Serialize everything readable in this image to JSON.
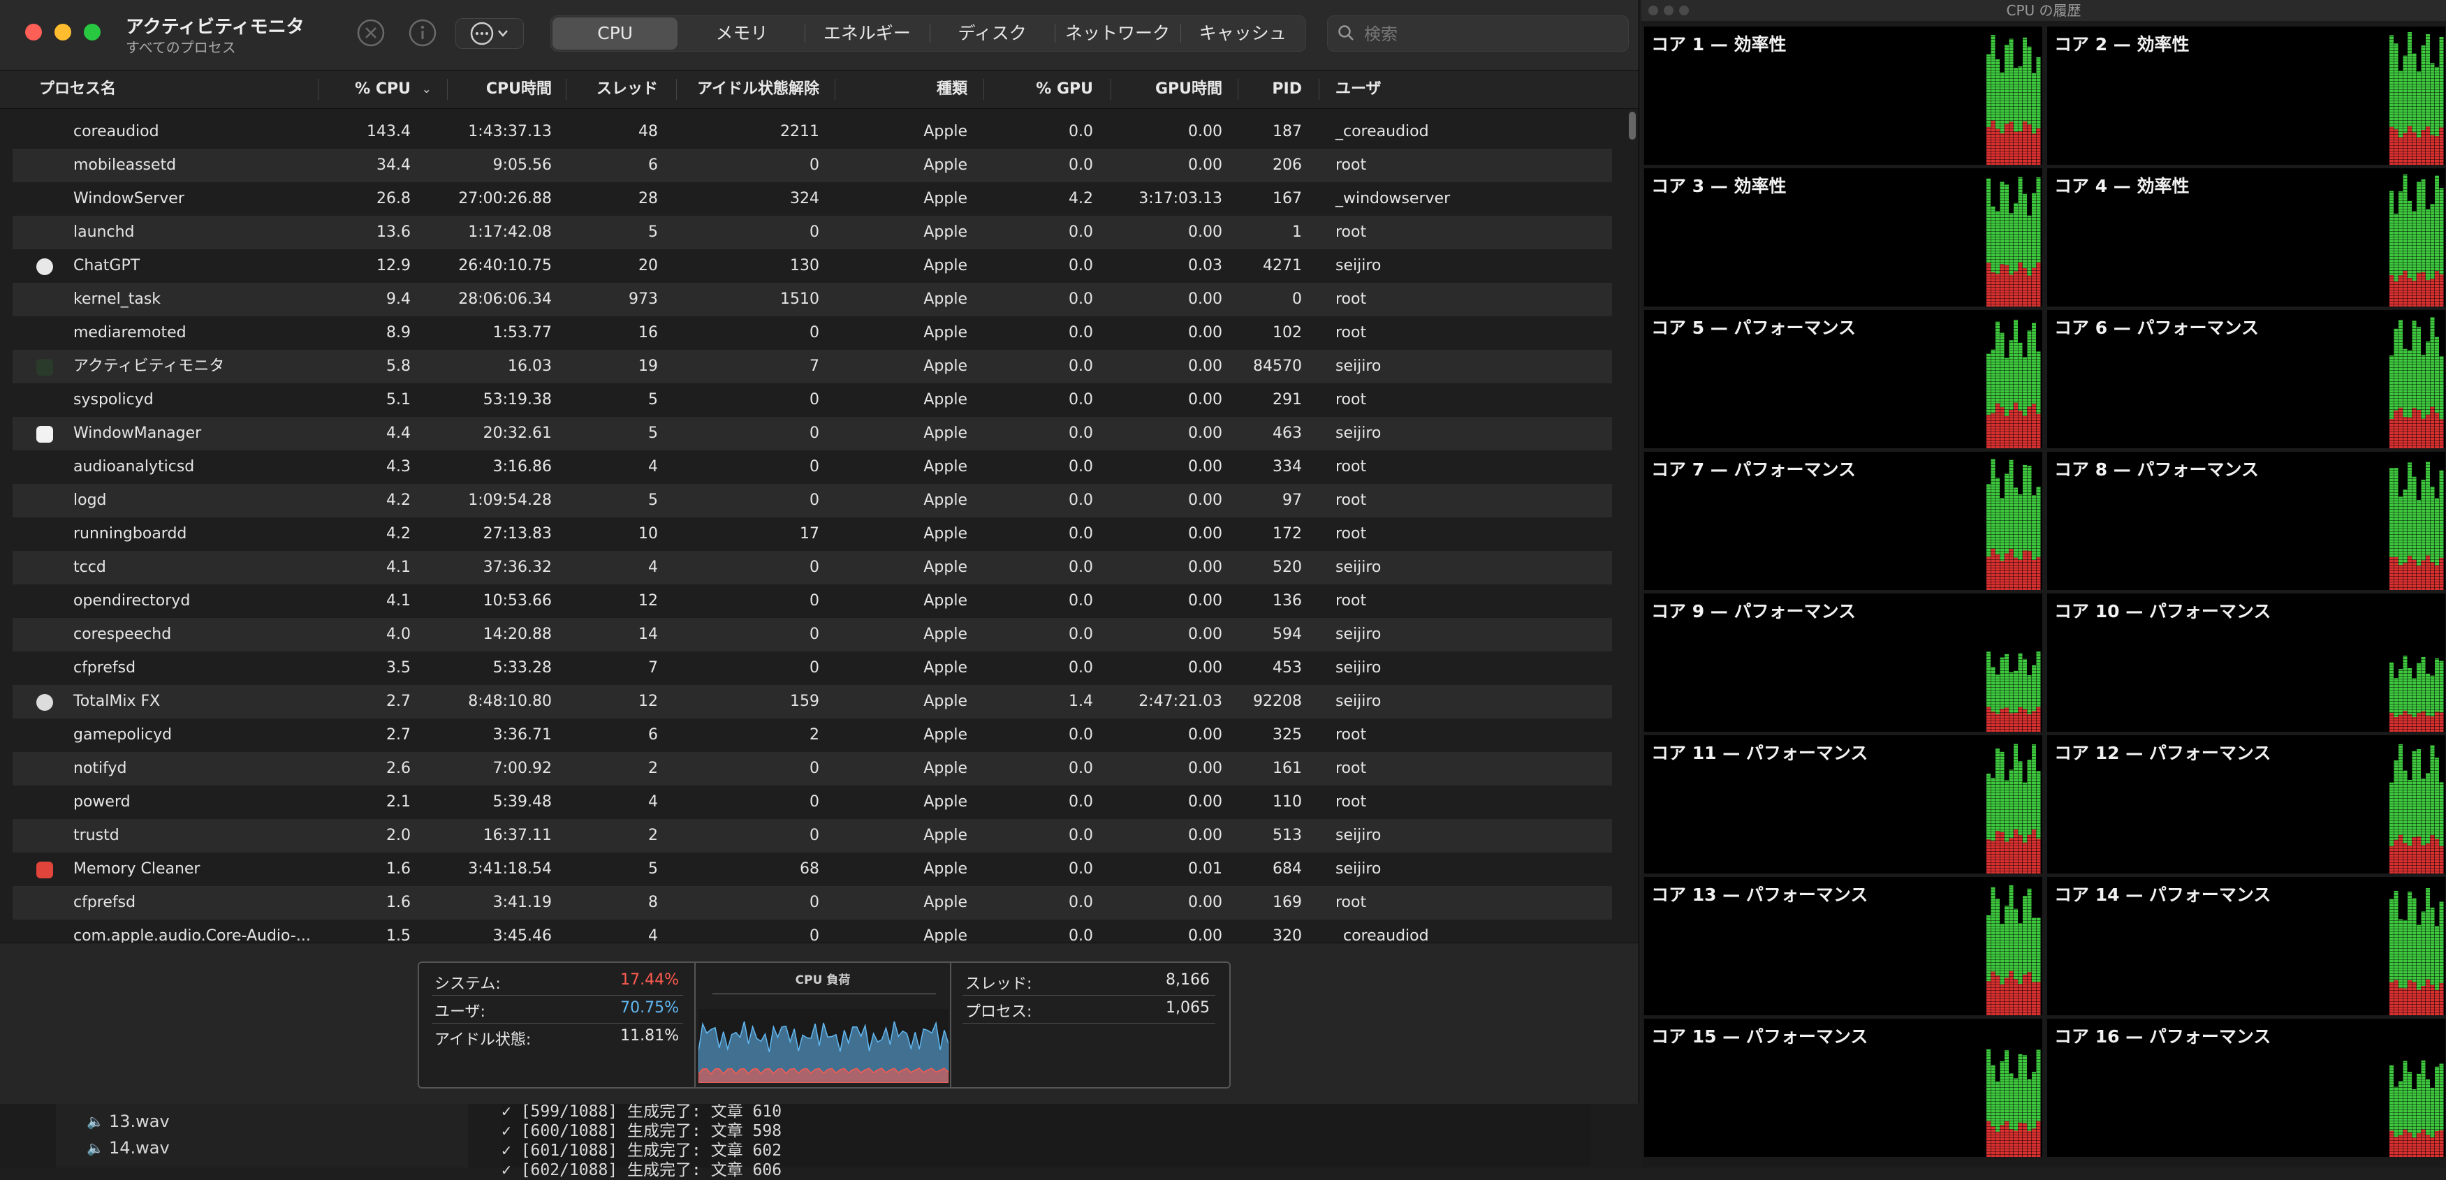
{
  "window": {
    "title": "アクティビティモニタ",
    "subtitle": "すべてのプロセス"
  },
  "toolbar": {
    "stop_icon": "x-circle-icon",
    "info_icon": "info-icon",
    "more_icon": "ellipsis-icon"
  },
  "tabs": [
    "CPU",
    "メモリ",
    "エネルギー",
    "ディスク",
    "ネットワーク",
    "キャッシュ"
  ],
  "active_tab": "CPU",
  "search": {
    "placeholder": "検索",
    "value": ""
  },
  "columns": [
    "プロセス名",
    "% CPU",
    "CPU時間",
    "スレッド",
    "アイドル状態解除",
    "種類",
    "% GPU",
    "GPU時間",
    "PID",
    "ユーザ"
  ],
  "processes": [
    {
      "name": "coreaudiod",
      "cpu": "143.4",
      "cpu_time": "1:43:37.13",
      "threads": "48",
      "wakeups": "2211",
      "kind": "Apple",
      "gpu": "0.0",
      "gpu_time": "0.00",
      "pid": "187",
      "user": "_coreaudiod",
      "icon": ""
    },
    {
      "name": "mobileassetd",
      "cpu": "34.4",
      "cpu_time": "9:05.56",
      "threads": "6",
      "wakeups": "0",
      "kind": "Apple",
      "gpu": "0.0",
      "gpu_time": "0.00",
      "pid": "206",
      "user": "root",
      "icon": ""
    },
    {
      "name": "WindowServer",
      "cpu": "26.8",
      "cpu_time": "27:00:26.88",
      "threads": "28",
      "wakeups": "324",
      "kind": "Apple",
      "gpu": "4.2",
      "gpu_time": "3:17:03.13",
      "pid": "167",
      "user": "_windowserver",
      "icon": ""
    },
    {
      "name": "launchd",
      "cpu": "13.6",
      "cpu_time": "1:17:42.08",
      "threads": "5",
      "wakeups": "0",
      "kind": "Apple",
      "gpu": "0.0",
      "gpu_time": "0.00",
      "pid": "1",
      "user": "root",
      "icon": ""
    },
    {
      "name": "ChatGPT",
      "cpu": "12.9",
      "cpu_time": "26:40:10.75",
      "threads": "20",
      "wakeups": "130",
      "kind": "Apple",
      "gpu": "0.0",
      "gpu_time": "0.03",
      "pid": "4271",
      "user": "seijiro",
      "icon": "chatgpt-icon"
    },
    {
      "name": "kernel_task",
      "cpu": "9.4",
      "cpu_time": "28:06:06.34",
      "threads": "973",
      "wakeups": "1510",
      "kind": "Apple",
      "gpu": "0.0",
      "gpu_time": "0.00",
      "pid": "0",
      "user": "root",
      "icon": ""
    },
    {
      "name": "mediaremoted",
      "cpu": "8.9",
      "cpu_time": "1:53.77",
      "threads": "16",
      "wakeups": "0",
      "kind": "Apple",
      "gpu": "0.0",
      "gpu_time": "0.00",
      "pid": "102",
      "user": "root",
      "icon": ""
    },
    {
      "name": "アクティビティモニタ",
      "cpu": "5.8",
      "cpu_time": "16.03",
      "threads": "19",
      "wakeups": "7",
      "kind": "Apple",
      "gpu": "0.0",
      "gpu_time": "0.00",
      "pid": "84570",
      "user": "seijiro",
      "icon": "activity-monitor-icon"
    },
    {
      "name": "syspolicyd",
      "cpu": "5.1",
      "cpu_time": "53:19.38",
      "threads": "5",
      "wakeups": "0",
      "kind": "Apple",
      "gpu": "0.0",
      "gpu_time": "0.00",
      "pid": "291",
      "user": "root",
      "icon": ""
    },
    {
      "name": "WindowManager",
      "cpu": "4.4",
      "cpu_time": "20:32.61",
      "threads": "5",
      "wakeups": "0",
      "kind": "Apple",
      "gpu": "0.0",
      "gpu_time": "0.00",
      "pid": "463",
      "user": "seijiro",
      "icon": "window-manager-icon"
    },
    {
      "name": "audioanalyticsd",
      "cpu": "4.3",
      "cpu_time": "3:16.86",
      "threads": "4",
      "wakeups": "0",
      "kind": "Apple",
      "gpu": "0.0",
      "gpu_time": "0.00",
      "pid": "334",
      "user": "root",
      "icon": ""
    },
    {
      "name": "logd",
      "cpu": "4.2",
      "cpu_time": "1:09:54.28",
      "threads": "5",
      "wakeups": "0",
      "kind": "Apple",
      "gpu": "0.0",
      "gpu_time": "0.00",
      "pid": "97",
      "user": "root",
      "icon": ""
    },
    {
      "name": "runningboardd",
      "cpu": "4.2",
      "cpu_time": "27:13.83",
      "threads": "10",
      "wakeups": "17",
      "kind": "Apple",
      "gpu": "0.0",
      "gpu_time": "0.00",
      "pid": "172",
      "user": "root",
      "icon": ""
    },
    {
      "name": "tccd",
      "cpu": "4.1",
      "cpu_time": "37:36.32",
      "threads": "4",
      "wakeups": "0",
      "kind": "Apple",
      "gpu": "0.0",
      "gpu_time": "0.00",
      "pid": "520",
      "user": "seijiro",
      "icon": ""
    },
    {
      "name": "opendirectoryd",
      "cpu": "4.1",
      "cpu_time": "10:53.66",
      "threads": "12",
      "wakeups": "0",
      "kind": "Apple",
      "gpu": "0.0",
      "gpu_time": "0.00",
      "pid": "136",
      "user": "root",
      "icon": ""
    },
    {
      "name": "corespeechd",
      "cpu": "4.0",
      "cpu_time": "14:20.88",
      "threads": "14",
      "wakeups": "0",
      "kind": "Apple",
      "gpu": "0.0",
      "gpu_time": "0.00",
      "pid": "594",
      "user": "seijiro",
      "icon": ""
    },
    {
      "name": "cfprefsd",
      "cpu": "3.5",
      "cpu_time": "5:33.28",
      "threads": "7",
      "wakeups": "0",
      "kind": "Apple",
      "gpu": "0.0",
      "gpu_time": "0.00",
      "pid": "453",
      "user": "seijiro",
      "icon": ""
    },
    {
      "name": "TotalMix FX",
      "cpu": "2.7",
      "cpu_time": "8:48:10.80",
      "threads": "12",
      "wakeups": "159",
      "kind": "Apple",
      "gpu": "1.4",
      "gpu_time": "2:47:21.03",
      "pid": "92208",
      "user": "seijiro",
      "icon": "totalmix-icon"
    },
    {
      "name": "gamepolicyd",
      "cpu": "2.7",
      "cpu_time": "3:36.71",
      "threads": "6",
      "wakeups": "2",
      "kind": "Apple",
      "gpu": "0.0",
      "gpu_time": "0.00",
      "pid": "325",
      "user": "root",
      "icon": ""
    },
    {
      "name": "notifyd",
      "cpu": "2.6",
      "cpu_time": "7:00.92",
      "threads": "2",
      "wakeups": "0",
      "kind": "Apple",
      "gpu": "0.0",
      "gpu_time": "0.00",
      "pid": "161",
      "user": "root",
      "icon": ""
    },
    {
      "name": "powerd",
      "cpu": "2.1",
      "cpu_time": "5:39.48",
      "threads": "4",
      "wakeups": "0",
      "kind": "Apple",
      "gpu": "0.0",
      "gpu_time": "0.00",
      "pid": "110",
      "user": "root",
      "icon": ""
    },
    {
      "name": "trustd",
      "cpu": "2.0",
      "cpu_time": "16:37.11",
      "threads": "2",
      "wakeups": "0",
      "kind": "Apple",
      "gpu": "0.0",
      "gpu_time": "0.00",
      "pid": "513",
      "user": "seijiro",
      "icon": ""
    },
    {
      "name": "Memory Cleaner",
      "cpu": "1.6",
      "cpu_time": "3:41:18.54",
      "threads": "5",
      "wakeups": "68",
      "kind": "Apple",
      "gpu": "0.0",
      "gpu_time": "0.01",
      "pid": "684",
      "user": "seijiro",
      "icon": "memory-cleaner-icon"
    },
    {
      "name": "cfprefsd",
      "cpu": "1.6",
      "cpu_time": "3:41.19",
      "threads": "8",
      "wakeups": "0",
      "kind": "Apple",
      "gpu": "0.0",
      "gpu_time": "0.00",
      "pid": "169",
      "user": "root",
      "icon": ""
    },
    {
      "name": "com.apple.audio.Core-Audio-...",
      "cpu": "1.5",
      "cpu_time": "3:45.46",
      "threads": "4",
      "wakeups": "0",
      "kind": "Apple",
      "gpu": "0.0",
      "gpu_time": "0.00",
      "pid": "320",
      "user": "_coreaudiod",
      "icon": ""
    }
  ],
  "stats": {
    "system_label": "システム:",
    "system_value": "17.44%",
    "user_label": "ユーザ:",
    "user_value": "70.75%",
    "idle_label": "アイドル状態:",
    "idle_value": "11.81%",
    "load_title": "CPU 負荷",
    "threads_label": "スレッド:",
    "threads_value": "8,166",
    "processes_label": "プロセス:",
    "processes_value": "1,065"
  },
  "colors": {
    "system": "#ff5b4f",
    "user": "#62b8f2",
    "green_bar": "#3ec93e",
    "red_bar": "#d93030"
  },
  "cpu_history": {
    "title": "CPU の履歴",
    "cores": [
      {
        "label": "コア 1 — 効率性",
        "user": 0.62,
        "system": 0.32
      },
      {
        "label": "コア 2 — 効率性",
        "user": 0.68,
        "system": 0.28
      },
      {
        "label": "コア 3 — 効率性",
        "user": 0.62,
        "system": 0.32
      },
      {
        "label": "コア 4 — 効率性",
        "user": 0.7,
        "system": 0.26
      },
      {
        "label": "コア 5 — パフォーマンス",
        "user": 0.6,
        "system": 0.33
      },
      {
        "label": "コア 6 — パフォーマンス",
        "user": 0.65,
        "system": 0.3
      },
      {
        "label": "コア 7 — パフォーマンス",
        "user": 0.65,
        "system": 0.3
      },
      {
        "label": "コア 8 — パフォーマンス",
        "user": 0.68,
        "system": 0.25
      },
      {
        "label": "コア 9 — パフォーマンス",
        "user": 0.4,
        "system": 0.18
      },
      {
        "label": "コア 10 — パフォーマンス",
        "user": 0.4,
        "system": 0.15
      },
      {
        "label": "コア 11 — パフォーマンス",
        "user": 0.62,
        "system": 0.32
      },
      {
        "label": "コア 12 — パフォーマンス",
        "user": 0.66,
        "system": 0.28
      },
      {
        "label": "コア 13 — パフォーマンス",
        "user": 0.62,
        "system": 0.32
      },
      {
        "label": "コア 14 — パフォーマンス",
        "user": 0.66,
        "system": 0.26
      },
      {
        "label": "コア 15 — パフォーマンス",
        "user": 0.52,
        "system": 0.26
      },
      {
        "label": "コア 16 — パフォーマンス",
        "user": 0.5,
        "system": 0.2
      }
    ]
  },
  "background": {
    "files": [
      "13.wav",
      "14.wav"
    ],
    "terminal_lines": [
      "✓ [599/1088] 生成完了: 文章 610",
      "✓ [600/1088] 生成完了: 文章 598",
      "✓ [601/1088] 生成完了: 文章 602",
      "✓ [602/1088] 生成完了: 文章 606"
    ]
  }
}
